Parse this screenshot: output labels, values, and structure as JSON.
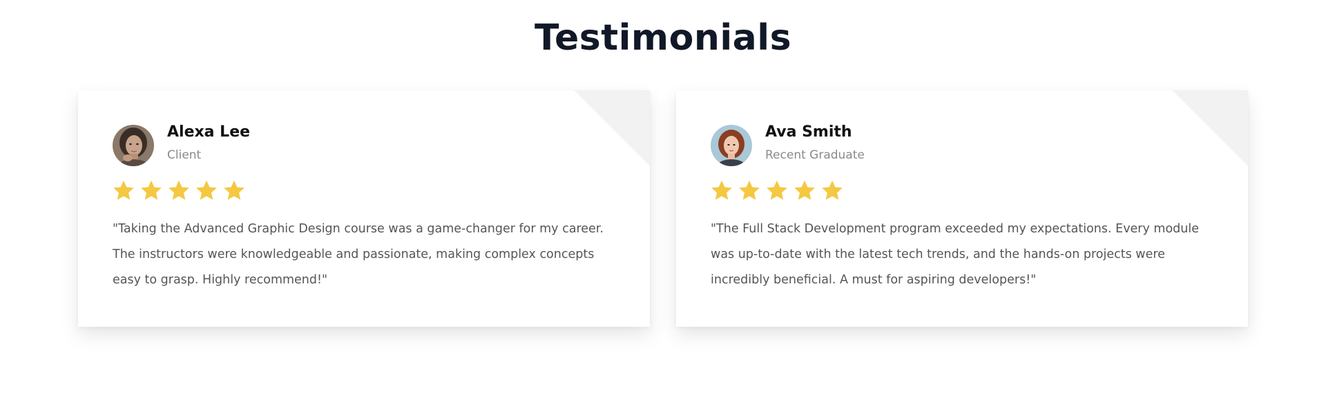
{
  "section": {
    "title": "Testimonials"
  },
  "colors": {
    "title": "#111827",
    "star": "#f5c842",
    "text": "#555555",
    "muted": "#8a8a8a"
  },
  "testimonials": [
    {
      "name": "Alexa Lee",
      "role": "Client",
      "rating": 5,
      "rating_max": 5,
      "quote": "\"Taking the Advanced Graphic Design course was a game-changer for my career. The instructors were knowledgeable and passionate, making complex concepts easy to grasp. Highly recommend!\"",
      "icon": "avatar-photo"
    },
    {
      "name": "Ava Smith",
      "role": "Recent Graduate",
      "rating": 5,
      "rating_max": 5,
      "quote": "\"The Full Stack Development program exceeded my expectations. Every module was up-to-date with the latest tech trends, and the hands-on projects were incredibly beneficial. A must for aspiring developers!\"",
      "icon": "avatar-photo"
    }
  ]
}
